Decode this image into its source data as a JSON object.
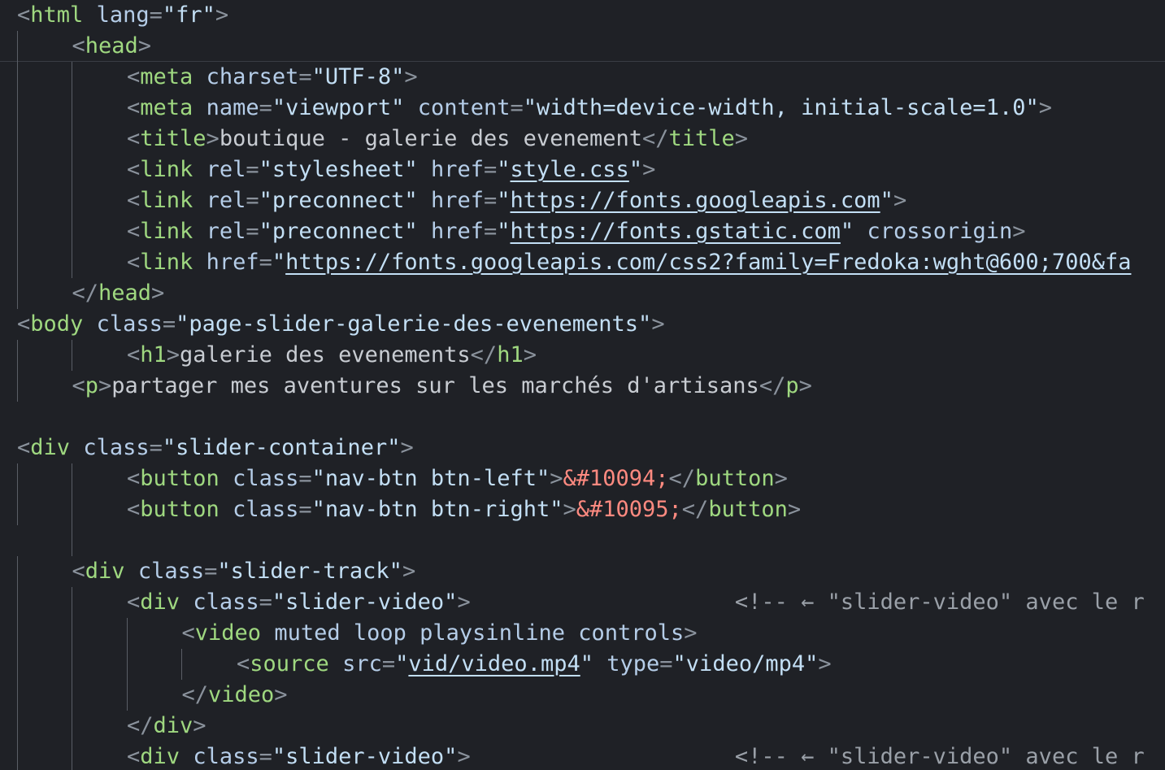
{
  "colors": {
    "background": "#1f2126",
    "punct": "#8a929c",
    "tag": "#9fd880",
    "attr": "#b5cde8",
    "string": "#c3dff5",
    "text": "#c8ccd2",
    "comment": "#9aa0a8",
    "entity": "#ff8a80",
    "guide": "#5a5e66",
    "sticky_separator": "#3a3d44"
  },
  "editor": {
    "language": "html",
    "lines": [
      {
        "indent": 0,
        "tokens": [
          {
            "t": "punct",
            "v": "<"
          },
          {
            "t": "tag",
            "v": "html"
          },
          {
            "t": "text",
            "v": " "
          },
          {
            "t": "attr",
            "v": "lang"
          },
          {
            "t": "punct",
            "v": "="
          },
          {
            "t": "string",
            "v": "\"fr\""
          },
          {
            "t": "punct",
            "v": ">"
          }
        ]
      },
      {
        "indent": 1,
        "tokens": [
          {
            "t": "punct",
            "v": "<"
          },
          {
            "t": "tag",
            "v": "head"
          },
          {
            "t": "punct",
            "v": ">"
          }
        ]
      },
      {
        "indent": 2,
        "tokens": [
          {
            "t": "punct",
            "v": "<"
          },
          {
            "t": "tag",
            "v": "meta"
          },
          {
            "t": "text",
            "v": " "
          },
          {
            "t": "attr",
            "v": "charset"
          },
          {
            "t": "punct",
            "v": "="
          },
          {
            "t": "string",
            "v": "\"UTF-8\""
          },
          {
            "t": "punct",
            "v": ">"
          }
        ]
      },
      {
        "indent": 2,
        "tokens": [
          {
            "t": "punct",
            "v": "<"
          },
          {
            "t": "tag",
            "v": "meta"
          },
          {
            "t": "text",
            "v": " "
          },
          {
            "t": "attr",
            "v": "name"
          },
          {
            "t": "punct",
            "v": "="
          },
          {
            "t": "string",
            "v": "\"viewport\""
          },
          {
            "t": "text",
            "v": " "
          },
          {
            "t": "attr",
            "v": "content"
          },
          {
            "t": "punct",
            "v": "="
          },
          {
            "t": "string",
            "v": "\"width=device-width, initial-scale=1.0\""
          },
          {
            "t": "punct",
            "v": ">"
          }
        ]
      },
      {
        "indent": 2,
        "tokens": [
          {
            "t": "punct",
            "v": "<"
          },
          {
            "t": "tag",
            "v": "title"
          },
          {
            "t": "punct",
            "v": ">"
          },
          {
            "t": "text",
            "v": "boutique - galerie des evenement"
          },
          {
            "t": "punct",
            "v": "</"
          },
          {
            "t": "tag",
            "v": "title"
          },
          {
            "t": "punct",
            "v": ">"
          }
        ]
      },
      {
        "indent": 2,
        "tokens": [
          {
            "t": "punct",
            "v": "<"
          },
          {
            "t": "tag",
            "v": "link"
          },
          {
            "t": "text",
            "v": " "
          },
          {
            "t": "attr",
            "v": "rel"
          },
          {
            "t": "punct",
            "v": "="
          },
          {
            "t": "string",
            "v": "\"stylesheet\""
          },
          {
            "t": "text",
            "v": " "
          },
          {
            "t": "attr",
            "v": "href"
          },
          {
            "t": "punct",
            "v": "="
          },
          {
            "t": "string",
            "v": "\""
          },
          {
            "t": "link",
            "v": "style.css"
          },
          {
            "t": "string",
            "v": "\""
          },
          {
            "t": "punct",
            "v": ">"
          }
        ]
      },
      {
        "indent": 2,
        "tokens": [
          {
            "t": "punct",
            "v": "<"
          },
          {
            "t": "tag",
            "v": "link"
          },
          {
            "t": "text",
            "v": " "
          },
          {
            "t": "attr",
            "v": "rel"
          },
          {
            "t": "punct",
            "v": "="
          },
          {
            "t": "string",
            "v": "\"preconnect\""
          },
          {
            "t": "text",
            "v": " "
          },
          {
            "t": "attr",
            "v": "href"
          },
          {
            "t": "punct",
            "v": "="
          },
          {
            "t": "string",
            "v": "\""
          },
          {
            "t": "link",
            "v": "https://fonts.googleapis.com"
          },
          {
            "t": "string",
            "v": "\""
          },
          {
            "t": "punct",
            "v": ">"
          }
        ]
      },
      {
        "indent": 2,
        "tokens": [
          {
            "t": "punct",
            "v": "<"
          },
          {
            "t": "tag",
            "v": "link"
          },
          {
            "t": "text",
            "v": " "
          },
          {
            "t": "attr",
            "v": "rel"
          },
          {
            "t": "punct",
            "v": "="
          },
          {
            "t": "string",
            "v": "\"preconnect\""
          },
          {
            "t": "text",
            "v": " "
          },
          {
            "t": "attr",
            "v": "href"
          },
          {
            "t": "punct",
            "v": "="
          },
          {
            "t": "string",
            "v": "\""
          },
          {
            "t": "link",
            "v": "https://fonts.gstatic.com"
          },
          {
            "t": "string",
            "v": "\""
          },
          {
            "t": "text",
            "v": " "
          },
          {
            "t": "attr",
            "v": "crossorigin"
          },
          {
            "t": "punct",
            "v": ">"
          }
        ]
      },
      {
        "indent": 2,
        "tokens": [
          {
            "t": "punct",
            "v": "<"
          },
          {
            "t": "tag",
            "v": "link"
          },
          {
            "t": "text",
            "v": " "
          },
          {
            "t": "attr",
            "v": "href"
          },
          {
            "t": "punct",
            "v": "="
          },
          {
            "t": "string",
            "v": "\""
          },
          {
            "t": "link",
            "v": "https://fonts.googleapis.com/css2?family=Fredoka:wght@600;700&fa"
          }
        ]
      },
      {
        "indent": 1,
        "tokens": [
          {
            "t": "punct",
            "v": "</"
          },
          {
            "t": "tag",
            "v": "head"
          },
          {
            "t": "punct",
            "v": ">"
          }
        ]
      },
      {
        "indent": 0,
        "tokens": [
          {
            "t": "punct",
            "v": "<"
          },
          {
            "t": "tag",
            "v": "body"
          },
          {
            "t": "text",
            "v": " "
          },
          {
            "t": "attr",
            "v": "class"
          },
          {
            "t": "punct",
            "v": "="
          },
          {
            "t": "string",
            "v": "\"page-slider-galerie-des-evenements\""
          },
          {
            "t": "punct",
            "v": ">"
          }
        ]
      },
      {
        "indent": 2,
        "tokens": [
          {
            "t": "punct",
            "v": "<"
          },
          {
            "t": "tag",
            "v": "h1"
          },
          {
            "t": "punct",
            "v": ">"
          },
          {
            "t": "text",
            "v": "galerie des evenements"
          },
          {
            "t": "punct",
            "v": "</"
          },
          {
            "t": "tag",
            "v": "h1"
          },
          {
            "t": "punct",
            "v": ">"
          }
        ]
      },
      {
        "indent": 1,
        "tokens": [
          {
            "t": "punct",
            "v": "<"
          },
          {
            "t": "tag",
            "v": "p"
          },
          {
            "t": "punct",
            "v": ">"
          },
          {
            "t": "text",
            "v": "partager mes aventures sur les marchés d'artisans"
          },
          {
            "t": "punct",
            "v": "</"
          },
          {
            "t": "tag",
            "v": "p"
          },
          {
            "t": "punct",
            "v": ">"
          }
        ]
      },
      {
        "indent": 0,
        "tokens": []
      },
      {
        "indent": 0,
        "tokens": [
          {
            "t": "punct",
            "v": "<"
          },
          {
            "t": "tag",
            "v": "div"
          },
          {
            "t": "text",
            "v": " "
          },
          {
            "t": "attr",
            "v": "class"
          },
          {
            "t": "punct",
            "v": "="
          },
          {
            "t": "string",
            "v": "\"slider-container\""
          },
          {
            "t": "punct",
            "v": ">"
          }
        ]
      },
      {
        "indent": 2,
        "tokens": [
          {
            "t": "punct",
            "v": "<"
          },
          {
            "t": "tag",
            "v": "button"
          },
          {
            "t": "text",
            "v": " "
          },
          {
            "t": "attr",
            "v": "class"
          },
          {
            "t": "punct",
            "v": "="
          },
          {
            "t": "string",
            "v": "\"nav-btn btn-left\""
          },
          {
            "t": "punct",
            "v": ">"
          },
          {
            "t": "entity",
            "v": "&#10094;"
          },
          {
            "t": "punct",
            "v": "</"
          },
          {
            "t": "tag",
            "v": "button"
          },
          {
            "t": "punct",
            "v": ">"
          }
        ]
      },
      {
        "indent": 2,
        "tokens": [
          {
            "t": "punct",
            "v": "<"
          },
          {
            "t": "tag",
            "v": "button"
          },
          {
            "t": "text",
            "v": " "
          },
          {
            "t": "attr",
            "v": "class"
          },
          {
            "t": "punct",
            "v": "="
          },
          {
            "t": "string",
            "v": "\"nav-btn btn-right\""
          },
          {
            "t": "punct",
            "v": ">"
          },
          {
            "t": "entity",
            "v": "&#10095;"
          },
          {
            "t": "punct",
            "v": "</"
          },
          {
            "t": "tag",
            "v": "button"
          },
          {
            "t": "punct",
            "v": ">"
          }
        ]
      },
      {
        "indent": 0,
        "tokens": []
      },
      {
        "indent": 1,
        "tokens": [
          {
            "t": "punct",
            "v": "<"
          },
          {
            "t": "tag",
            "v": "div"
          },
          {
            "t": "text",
            "v": " "
          },
          {
            "t": "attr",
            "v": "class"
          },
          {
            "t": "punct",
            "v": "="
          },
          {
            "t": "string",
            "v": "\"slider-track\""
          },
          {
            "t": "punct",
            "v": ">"
          }
        ]
      },
      {
        "indent": 2,
        "tokens": [
          {
            "t": "punct",
            "v": "<"
          },
          {
            "t": "tag",
            "v": "div"
          },
          {
            "t": "text",
            "v": " "
          },
          {
            "t": "attr",
            "v": "class"
          },
          {
            "t": "punct",
            "v": "="
          },
          {
            "t": "string",
            "v": "\"slider-video\""
          },
          {
            "t": "punct",
            "v": ">"
          },
          {
            "t": "text",
            "v": "                    "
          },
          {
            "t": "comment",
            "v": "<!-- ← \"slider-video\" avec le r"
          }
        ]
      },
      {
        "indent": 3,
        "tokens": [
          {
            "t": "punct",
            "v": "<"
          },
          {
            "t": "tag",
            "v": "video"
          },
          {
            "t": "text",
            "v": " "
          },
          {
            "t": "attr",
            "v": "muted"
          },
          {
            "t": "text",
            "v": " "
          },
          {
            "t": "attr",
            "v": "loop"
          },
          {
            "t": "text",
            "v": " "
          },
          {
            "t": "attr",
            "v": "playsinline"
          },
          {
            "t": "text",
            "v": " "
          },
          {
            "t": "attr",
            "v": "controls"
          },
          {
            "t": "punct",
            "v": ">"
          }
        ]
      },
      {
        "indent": 4,
        "tokens": [
          {
            "t": "punct",
            "v": "<"
          },
          {
            "t": "tag",
            "v": "source"
          },
          {
            "t": "text",
            "v": " "
          },
          {
            "t": "attr",
            "v": "src"
          },
          {
            "t": "punct",
            "v": "="
          },
          {
            "t": "string",
            "v": "\""
          },
          {
            "t": "link",
            "v": "vid/video.mp4"
          },
          {
            "t": "string",
            "v": "\""
          },
          {
            "t": "text",
            "v": " "
          },
          {
            "t": "attr",
            "v": "type"
          },
          {
            "t": "punct",
            "v": "="
          },
          {
            "t": "string",
            "v": "\"video/mp4\""
          },
          {
            "t": "punct",
            "v": ">"
          }
        ]
      },
      {
        "indent": 3,
        "tokens": [
          {
            "t": "punct",
            "v": "</"
          },
          {
            "t": "tag",
            "v": "video"
          },
          {
            "t": "punct",
            "v": ">"
          }
        ]
      },
      {
        "indent": 2,
        "tokens": [
          {
            "t": "punct",
            "v": "</"
          },
          {
            "t": "tag",
            "v": "div"
          },
          {
            "t": "punct",
            "v": ">"
          }
        ]
      },
      {
        "indent": 2,
        "tokens": [
          {
            "t": "punct",
            "v": "<"
          },
          {
            "t": "tag",
            "v": "div"
          },
          {
            "t": "text",
            "v": " "
          },
          {
            "t": "attr",
            "v": "class"
          },
          {
            "t": "punct",
            "v": "="
          },
          {
            "t": "string",
            "v": "\"slider-video\""
          },
          {
            "t": "punct",
            "v": ">"
          },
          {
            "t": "text",
            "v": "                    "
          },
          {
            "t": "comment",
            "v": "<!-- ← \"slider-video\" avec le r"
          }
        ]
      }
    ]
  }
}
